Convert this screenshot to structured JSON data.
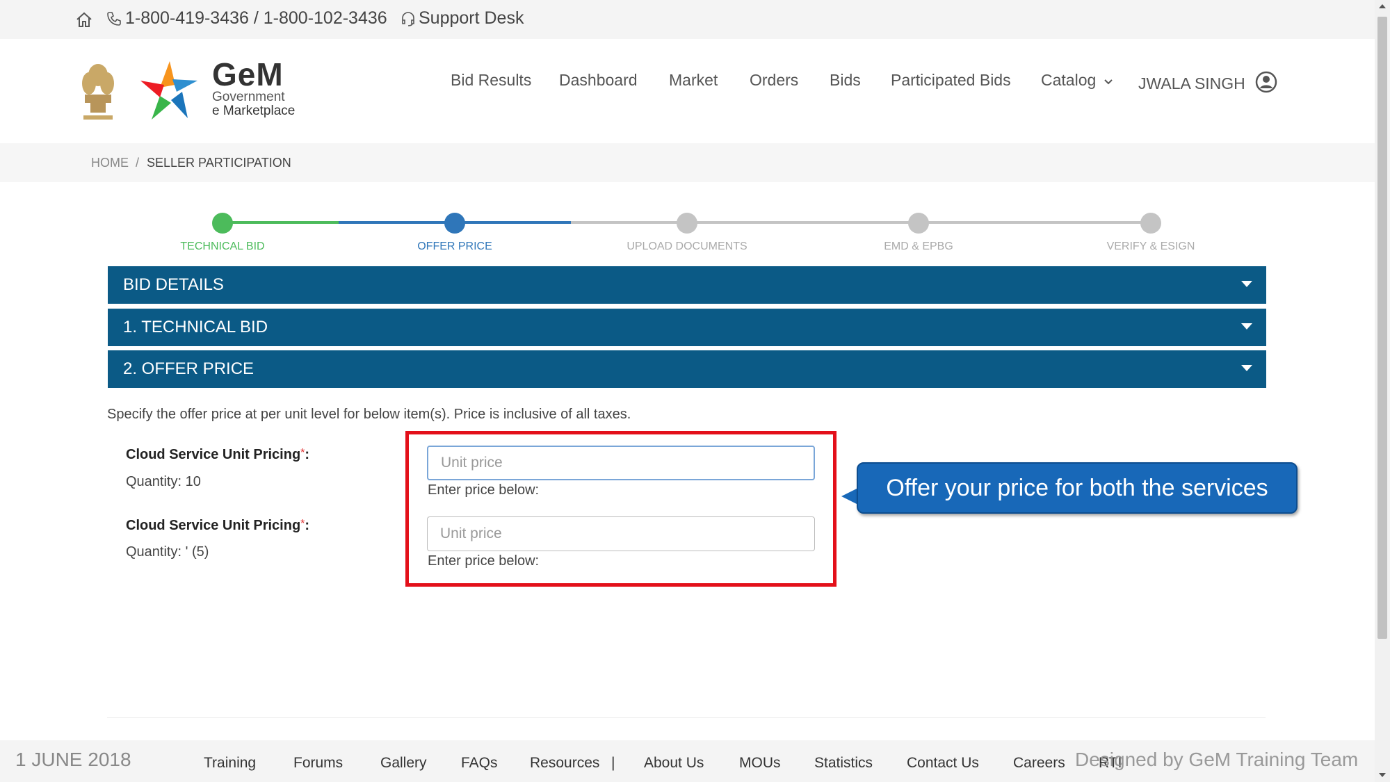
{
  "topbar": {
    "phone": "1-800-419-3436 / 1-800-102-3436",
    "support": "Support Desk"
  },
  "brand": {
    "name": "GeM",
    "line1": "Government",
    "line2": "e Marketplace"
  },
  "nav": {
    "items": [
      "Bid Results",
      "Dashboard",
      "Market",
      "Orders",
      "Bids",
      "Participated Bids",
      "Catalog"
    ],
    "user": "JWALA SINGH"
  },
  "breadcrumb": {
    "home": "HOME",
    "current": "SELLER PARTICIPATION"
  },
  "stepper": {
    "steps": [
      {
        "label": "TECHNICAL BID",
        "status": "done"
      },
      {
        "label": "OFFER PRICE",
        "status": "active"
      },
      {
        "label": "UPLOAD DOCUMENTS",
        "status": "pending"
      },
      {
        "label": "EMD & EPBG",
        "status": "pending"
      },
      {
        "label": "VERIFY & ESIGN",
        "status": "pending"
      }
    ],
    "colors": {
      "done": "#4cbb5b",
      "active": "#2f76b9",
      "pending": "#c4c4c4"
    }
  },
  "sections": [
    "BID DETAILS",
    "1. TECHNICAL BID",
    "2. OFFER PRICE"
  ],
  "offer": {
    "instruction": "Specify the offer price at per unit level for below item(s). Price is inclusive of all taxes.",
    "items": [
      {
        "label": "Cloud Service Unit Pricing",
        "required": "*",
        "colon": ":",
        "quantity": "Quantity: 10",
        "placeholder": "Unit price",
        "hint": "Enter price below:"
      },
      {
        "label": "Cloud Service Unit Pricing",
        "required": "*",
        "colon": ":",
        "quantity": "Quantity: ' (5)",
        "placeholder": "Unit price",
        "hint": "Enter price below:"
      }
    ]
  },
  "callout": "Offer your price for both the services",
  "footer": {
    "date": "1 JUNE 2018",
    "links": [
      "Training",
      "Forums",
      "Gallery",
      "FAQs",
      "Resources",
      "|",
      "About Us",
      "MOUs",
      "Statistics",
      "Contact Us",
      "Careers",
      "RTI"
    ],
    "designed": "Designed by GeM Training Team"
  },
  "colors": {
    "accordion": "#0b5a86",
    "highlight": "#e3101a",
    "callout": "#1868b8"
  }
}
